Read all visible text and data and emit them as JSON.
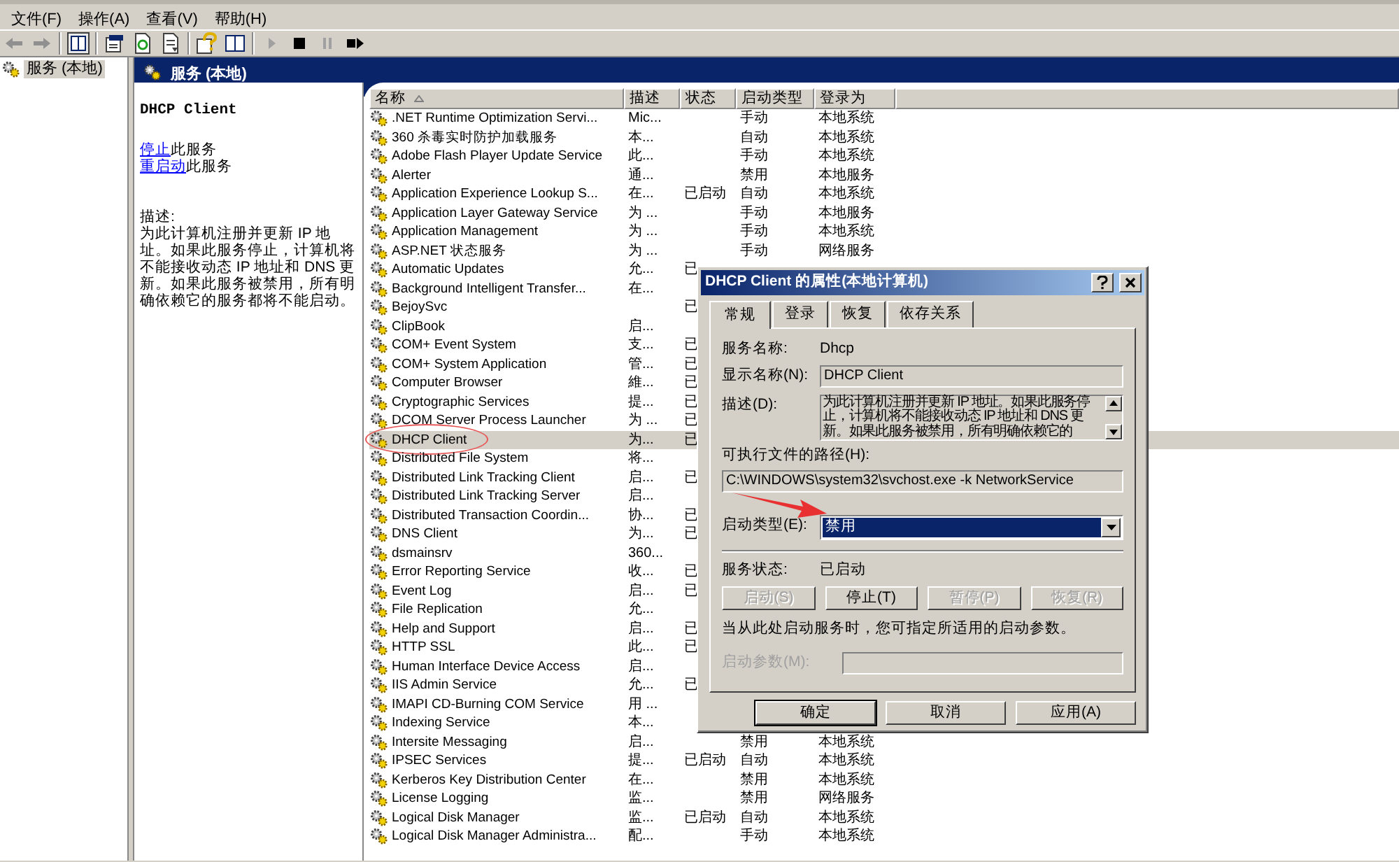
{
  "menu": [
    "文件(F)",
    "操作(A)",
    "查看(V)",
    "帮助(H)"
  ],
  "tree": {
    "items": [
      {
        "label": "服务 (本地)",
        "selected": true
      }
    ]
  },
  "panel": {
    "title": "服务 (本地)"
  },
  "details": {
    "title": "DHCP Client",
    "actions": [
      {
        "link": "停止",
        "text": "此服务"
      },
      {
        "link": "重启动",
        "text": "此服务"
      }
    ],
    "description_label": "描述:",
    "description": "为此计算机注册并更新 IP 地址。如果此服务停止，计算机将不能接收动态 IP 地址和 DNS 更新。如果此服务被禁用，所有明确依赖它的服务都将不能启动。"
  },
  "table": {
    "columns": [
      {
        "label": "名称",
        "sorted": true
      },
      {
        "label": "描述",
        "sorted": false
      },
      {
        "label": "状态",
        "sorted": false
      },
      {
        "label": "启动类型",
        "sorted": false
      },
      {
        "label": "登录为",
        "sorted": false
      }
    ],
    "rows": [
      {
        "name": ".NET Runtime Optimization Servi...",
        "description": "Mic...",
        "start_type": "手动",
        "logon": "本地系统",
        "selected": false
      },
      {
        "name": "360 杀毒实时防护加载服务",
        "description": "本...",
        "start_type": "自动",
        "logon": "本地系统",
        "selected": false
      },
      {
        "name": "Adobe Flash Player Update Service",
        "description": "此...",
        "start_type": "手动",
        "logon": "本地系统",
        "selected": false
      },
      {
        "name": "Alerter",
        "description": "通...",
        "start_type": "禁用",
        "logon": "本地服务",
        "selected": false
      },
      {
        "name": "Application Experience Lookup S...",
        "description": "在...",
        "status": "已启动",
        "start_type": "自动",
        "logon": "本地系统",
        "selected": false
      },
      {
        "name": "Application Layer Gateway Service",
        "description": "为 ...",
        "start_type": "手动",
        "logon": "本地服务",
        "selected": false
      },
      {
        "name": "Application Management",
        "description": "为 ...",
        "start_type": "手动",
        "logon": "本地系统",
        "selected": false
      },
      {
        "name": "ASP.NET 状态服务",
        "description": "为 ...",
        "start_type": "手动",
        "logon": "网络服务",
        "selected": false
      },
      {
        "name": "Automatic Updates",
        "description": "允...",
        "status": "已",
        "selected": false
      },
      {
        "name": "Background Intelligent Transfer...",
        "description": "在...",
        "selected": false
      },
      {
        "name": "BejoySvc",
        "status": "已",
        "selected": false
      },
      {
        "name": "ClipBook",
        "description": "启...",
        "selected": false
      },
      {
        "name": "COM+ Event System",
        "description": "支...",
        "status": "已",
        "selected": false
      },
      {
        "name": "COM+ System Application",
        "description": "管...",
        "status": "已",
        "selected": false
      },
      {
        "name": "Computer Browser",
        "description": "維...",
        "status": "已",
        "selected": false
      },
      {
        "name": "Cryptographic Services",
        "description": "提...",
        "status": "已",
        "selected": false
      },
      {
        "name": "DCOM Server Process Launcher",
        "description": "为 ...",
        "status": "已",
        "selected": false
      },
      {
        "name": "DHCP Client",
        "description": "为...",
        "status": "已",
        "selected": true,
        "circled": true
      },
      {
        "name": "Distributed File System",
        "description": "将...",
        "selected": false
      },
      {
        "name": "Distributed Link Tracking Client",
        "description": "启...",
        "status": "已",
        "selected": false
      },
      {
        "name": "Distributed Link Tracking Server",
        "description": "启...",
        "selected": false
      },
      {
        "name": "Distributed Transaction Coordin...",
        "description": "协...",
        "status": "已",
        "selected": false
      },
      {
        "name": "DNS Client",
        "description": "为...",
        "status": "已",
        "selected": false
      },
      {
        "name": "dsmainsrv",
        "description": "360...",
        "selected": false
      },
      {
        "name": "Error Reporting Service",
        "description": "收...",
        "status": "已",
        "selected": false
      },
      {
        "name": "Event Log",
        "description": "启...",
        "status": "已",
        "selected": false
      },
      {
        "name": "File Replication",
        "description": "允...",
        "selected": false
      },
      {
        "name": "Help and Support",
        "description": "启...",
        "status": "已",
        "selected": false
      },
      {
        "name": "HTTP SSL",
        "description": "此...",
        "status": "已",
        "selected": false
      },
      {
        "name": "Human Interface Device Access",
        "description": "启...",
        "selected": false
      },
      {
        "name": "IIS Admin Service",
        "description": "允...",
        "status": "已",
        "selected": false
      },
      {
        "name": "IMAPI CD-Burning COM Service",
        "description": "用 ...",
        "selected": false
      },
      {
        "name": "Indexing Service",
        "description": "本...",
        "selected": false
      },
      {
        "name": "Intersite Messaging",
        "description": "启...",
        "start_type": "禁用",
        "logon": "本地系统",
        "selected": false
      },
      {
        "name": "IPSEC Services",
        "description": "提...",
        "status": "已启动",
        "start_type": "自动",
        "logon": "本地系统",
        "selected": false
      },
      {
        "name": "Kerberos Key Distribution Center",
        "description": "在...",
        "start_type": "禁用",
        "logon": "本地系统",
        "selected": false
      },
      {
        "name": "License Logging",
        "description": "监...",
        "start_type": "禁用",
        "logon": "网络服务",
        "selected": false
      },
      {
        "name": "Logical Disk Manager",
        "description": "监...",
        "status": "已启动",
        "start_type": "自动",
        "logon": "本地系统",
        "selected": false
      },
      {
        "name": "Logical Disk Manager Administra...",
        "description": "配...",
        "start_type": "手动",
        "logon": "本地系统",
        "selected": false
      }
    ]
  },
  "dialog": {
    "title": "DHCP Client 的属性(本地计算机)",
    "tabs": [
      {
        "label": "常规",
        "selected": true
      },
      {
        "label": "登录",
        "selected": false
      },
      {
        "label": "恢复",
        "selected": false
      },
      {
        "label": "依存关系",
        "selected": false
      }
    ],
    "service_name": {
      "label": "服务名称:",
      "value": "Dhcp"
    },
    "display_name": {
      "label": "显示名称(N):",
      "value": "DHCP Client"
    },
    "description": {
      "label": "描述(D):",
      "value": "为此计算机注册并更新 IP 地址。如果此服务停止，计算机将不能接收动态 IP 地址和 DNS 更新。如果此服务被禁用，所有明确依赖它的"
    },
    "path": {
      "label": "可执行文件的路径(H):",
      "value": "C:\\WINDOWS\\system32\\svchost.exe -k NetworkService"
    },
    "startup_type": {
      "label": "启动类型(E):",
      "value": "禁用",
      "pointed": true
    },
    "service_status": {
      "label": "服务状态:",
      "value": "已启动"
    },
    "control_buttons": [
      {
        "label": "启动(S)",
        "disabled": true
      },
      {
        "label": "停止(T)",
        "disabled": false
      },
      {
        "label": "暂停(P)",
        "disabled": true
      },
      {
        "label": "恢复(R)",
        "disabled": true
      }
    ],
    "hint": "当从此处启动服务时，您可指定所适用的启动参数。",
    "start_parameters": {
      "label": "启动参数(M):",
      "disabled": true
    },
    "buttons": [
      {
        "label": "确定",
        "default": true
      },
      {
        "label": "取消",
        "default": false
      },
      {
        "label": "应用(A)",
        "default": false
      }
    ]
  }
}
